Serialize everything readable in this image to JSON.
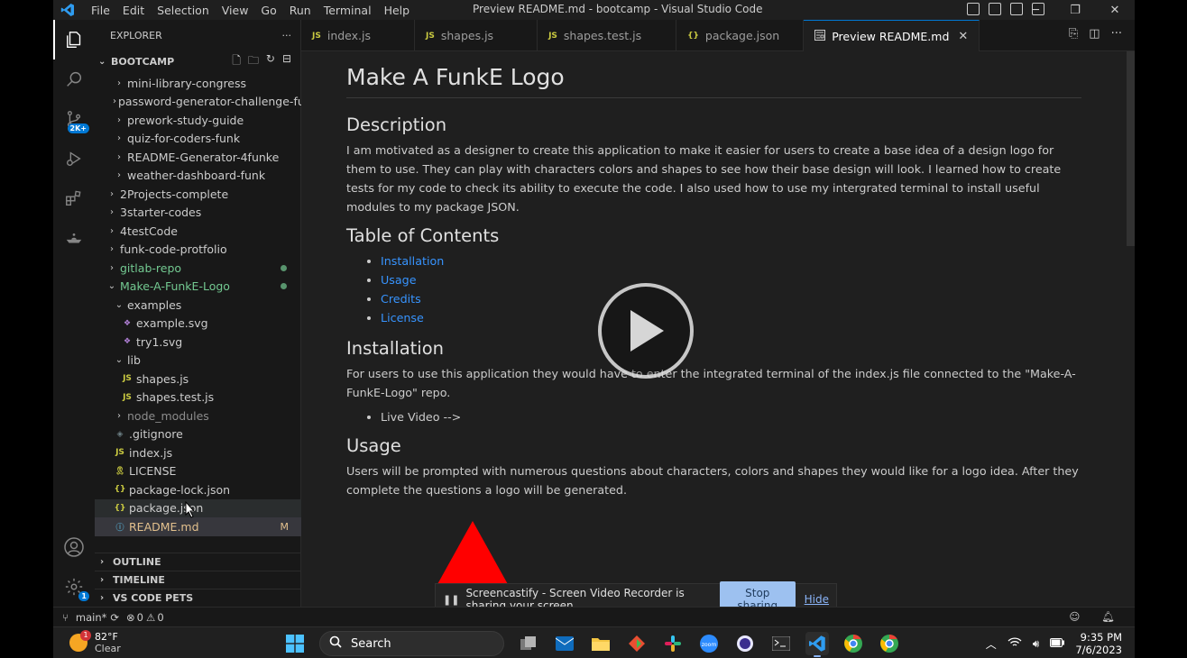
{
  "titlebar": {
    "menu": [
      "File",
      "Edit",
      "Selection",
      "View",
      "Go",
      "Run",
      "Terminal",
      "Help"
    ],
    "title": "Preview README.md - bootcamp - Visual Studio Code",
    "window_controls": [
      "─",
      "❐",
      "✕"
    ]
  },
  "activity": {
    "items": [
      "explorer-icon",
      "search-icon",
      "source-control-icon",
      "run-debug-icon",
      "extensions-icon",
      "genie-icon"
    ],
    "scm_badge": "2K+",
    "settings_badge": "1"
  },
  "sidebar": {
    "header": "EXPLORER",
    "header_more": "···",
    "root": "BOOTCAMP",
    "tree": [
      {
        "label": "mini-library-congress",
        "depth": 2,
        "type": "folder-closed"
      },
      {
        "label": "password-generator-challenge-fu...",
        "depth": 2,
        "type": "folder-closed"
      },
      {
        "label": "prework-study-guide",
        "depth": 2,
        "type": "folder-closed"
      },
      {
        "label": "quiz-for-coders-funk",
        "depth": 2,
        "type": "folder-closed"
      },
      {
        "label": "README-Generator-4funke",
        "depth": 2,
        "type": "folder-closed"
      },
      {
        "label": "weather-dashboard-funk",
        "depth": 2,
        "type": "folder-closed"
      },
      {
        "label": "2Projects-complete",
        "depth": 1,
        "type": "folder-closed"
      },
      {
        "label": "3starter-codes",
        "depth": 1,
        "type": "folder-closed"
      },
      {
        "label": "4testCode",
        "depth": 1,
        "type": "folder-closed"
      },
      {
        "label": "funk-code-protfolio",
        "depth": 1,
        "type": "folder-closed"
      },
      {
        "label": "gitlab-repo",
        "depth": 1,
        "type": "folder-closed",
        "status": "green"
      },
      {
        "label": "Make-A-FunkE-Logo",
        "depth": 1,
        "type": "folder-open",
        "status": "green"
      },
      {
        "label": "examples",
        "depth": 2,
        "type": "folder-open"
      },
      {
        "label": "example.svg",
        "depth": 3,
        "type": "svg"
      },
      {
        "label": "try1.svg",
        "depth": 3,
        "type": "svg"
      },
      {
        "label": "lib",
        "depth": 2,
        "type": "folder-open"
      },
      {
        "label": "shapes.js",
        "depth": 3,
        "type": "js"
      },
      {
        "label": "shapes.test.js",
        "depth": 3,
        "type": "js"
      },
      {
        "label": "node_modules",
        "depth": 2,
        "type": "folder-closed",
        "status": "dim"
      },
      {
        "label": ".gitignore",
        "depth": 2,
        "type": "git"
      },
      {
        "label": "index.js",
        "depth": 2,
        "type": "js"
      },
      {
        "label": "LICENSE",
        "depth": 2,
        "type": "license"
      },
      {
        "label": "package-lock.json",
        "depth": 2,
        "type": "json"
      },
      {
        "label": "package.json",
        "depth": 2,
        "type": "json",
        "hover": true
      },
      {
        "label": "README.md",
        "depth": 2,
        "type": "info",
        "selected": true,
        "flag": "M"
      }
    ],
    "panels": [
      "OUTLINE",
      "TIMELINE",
      "VS CODE PETS"
    ]
  },
  "tabs": [
    {
      "label": "index.js",
      "icon": "JS"
    },
    {
      "label": "shapes.js",
      "icon": "JS"
    },
    {
      "label": "shapes.test.js",
      "icon": "JS"
    },
    {
      "label": "package.json",
      "icon": "{}"
    },
    {
      "label": "Preview README.md",
      "icon": "preview",
      "active": true
    }
  ],
  "preview": {
    "h1": "Make A FunkE Logo",
    "description_heading": "Description",
    "description": "I am motivated as a designer to create this application to make it easier for users to create a base idea of a design logo for them to use. They can play with characters colors and shapes to see how their base design will look. I learned how to create tests for my code to check its ability to execute the code. I also used how to use my intergrated terminal to install useful modules to my package JSON.",
    "toc_heading": "Table of Contents",
    "toc": [
      "Installation",
      "Usage",
      "Credits",
      "License"
    ],
    "installation_heading": "Installation",
    "installation": "For users to use this application they would have to enter the integrated terminal of the index.js file connected to the \"Make-A-FunkE-Logo\" repo.",
    "installation_list": [
      "Live Video -->"
    ],
    "usage_heading": "Usage",
    "usage": "Users will be prompted with numerous questions about characters, colors and shapes they would like for a logo idea. After they complete the questions a logo will be generated."
  },
  "share_bar": {
    "message": "Screencastify - Screen Video Recorder is sharing your screen.",
    "stop_label": "Stop sharing",
    "hide_label": "Hide"
  },
  "statusbar": {
    "branch": "main*",
    "errors": "0",
    "warnings": "0"
  },
  "taskbar": {
    "temperature": "82°F",
    "condition": "Clear",
    "weather_badge": "1",
    "search_placeholder": "Search",
    "time": "9:35 PM",
    "date": "7/6/2023"
  },
  "colors": {
    "accent": "#0078d4",
    "link": "#3794ff",
    "git_added": "#73c991",
    "git_modified": "#e2c08d",
    "logo_red": "#ff0000"
  }
}
